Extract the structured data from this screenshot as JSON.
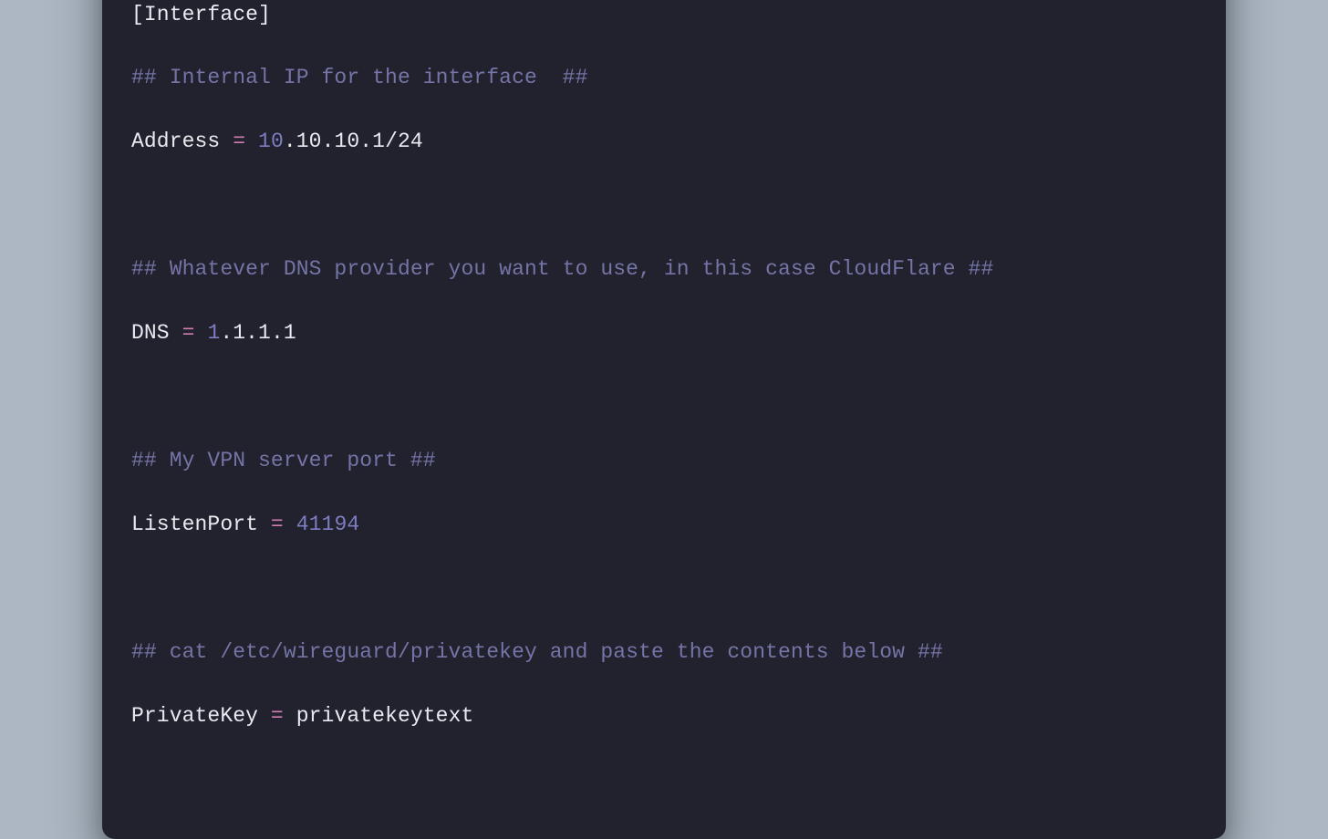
{
  "window": {
    "traffic_lights": {
      "red": "#ff5f57",
      "yellow": "#febc2e",
      "green": "#28c840"
    },
    "background": "#21222d"
  },
  "code": {
    "section_header": "[Interface]",
    "comment_address": "## Internal IP for the interface  ##",
    "address_key": "Address",
    "address_eq": " = ",
    "address_num": "10",
    "address_rest": ".10.10.1/24",
    "comment_dns": "## Whatever DNS provider you want to use, in this case CloudFlare ##",
    "dns_key": "DNS",
    "dns_eq": " = ",
    "dns_num": "1",
    "dns_rest": ".1.1.1",
    "comment_port": "## My VPN server port ##",
    "port_key": "ListenPort",
    "port_eq": " = ",
    "port_num": "41194",
    "comment_pk": "## cat /etc/wireguard/privatekey and paste the contents below ##",
    "pk_key": "PrivateKey",
    "pk_eq": " = ",
    "pk_val": "privatekeytext"
  }
}
